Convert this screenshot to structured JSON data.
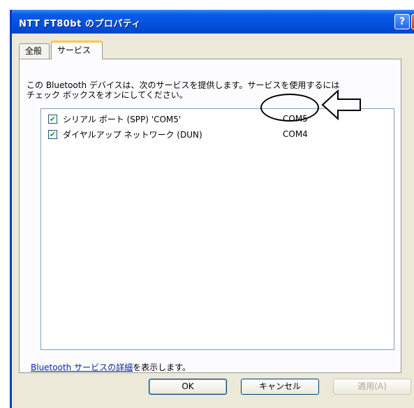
{
  "window": {
    "title": "NTT FT80bt のプロパティ"
  },
  "titlebar_buttons": {
    "help": "?",
    "close": "X"
  },
  "tabs": [
    {
      "label": "全般"
    },
    {
      "label": "サービス"
    }
  ],
  "description": {
    "line1": "この Bluetooth デバイスは、次のサービスを提供します。サービスを使用するには",
    "line2": "チェック ボックスをオンにしてください。"
  },
  "services": [
    {
      "name": "シリアル ポート (SPP) 'COM5'",
      "port": "COM5",
      "checked": true
    },
    {
      "name": "ダイヤルアップ ネットワーク (DUN)",
      "port": "COM4",
      "checked": true
    }
  ],
  "details": {
    "link_text": "Bluetooth サービスの詳細",
    "suffix": "を表示します。"
  },
  "buttons": {
    "ok": "OK",
    "cancel": "キャンセル",
    "apply": "適用(A)"
  },
  "icons": {
    "check": "checkmark-icon",
    "arrow": "arrow-left-icon"
  }
}
